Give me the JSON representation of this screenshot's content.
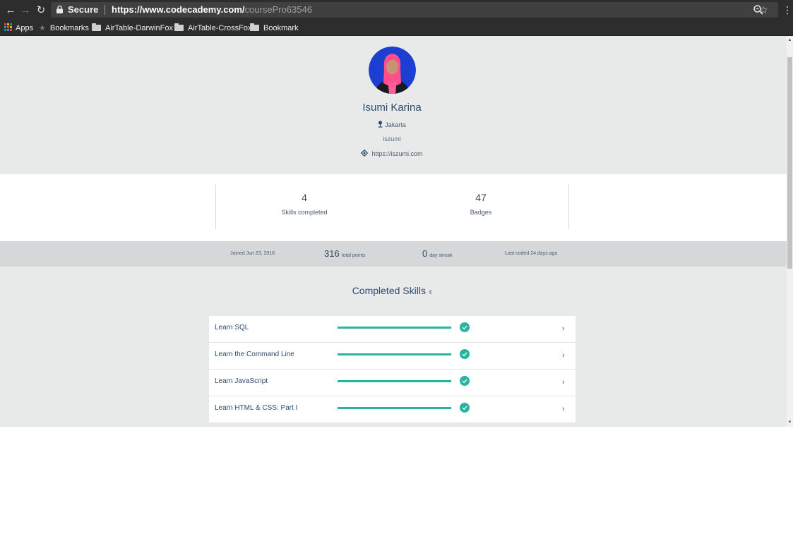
{
  "browser": {
    "back_icon": "arrow-left-icon",
    "forward_icon": "arrow-right-icon",
    "reload_icon": "reload-icon",
    "secure_label": "Secure",
    "url_host": "https://www.codecademy.com/",
    "url_path": "coursePro63546",
    "bookmarks": [
      "Apps",
      "Bookmarks",
      "AirTable-DarwinFox",
      "AirTable-CrossFox",
      "Bookmark"
    ]
  },
  "profile": {
    "name": "Isumi Karina",
    "location": "Jakarta",
    "username": "iszumi",
    "website": "https://iszumi.com"
  },
  "stats": {
    "skills_value": "4",
    "skills_label": "Skills completed",
    "badges_value": "47",
    "badges_label": "Badges"
  },
  "activity": {
    "joined": "Joined Jun 23, 2016",
    "points_value": "316",
    "points_label": "total points",
    "streak_value": "0",
    "streak_label": "day streak",
    "last_coded": "Last coded 24 days ago"
  },
  "completed": {
    "title": "Completed Skills",
    "count": "4",
    "skills": [
      {
        "name": "Learn SQL",
        "progress": 1.0,
        "status_icon": "check-circle-icon"
      },
      {
        "name": "Learn the Command Line",
        "progress": 1.0,
        "status_icon": "check-circle-icon"
      },
      {
        "name": "Learn JavaScript",
        "progress": 1.0,
        "status_icon": "check-circle-icon"
      },
      {
        "name": "Learn HTML & CSS: Part I",
        "progress": 1.0,
        "status_icon": "check-circle-icon"
      }
    ]
  },
  "colors": {
    "accent": "#2bb3a0",
    "text": "#2e4a6b",
    "header_bg": "#e8eaea",
    "chrome_bg": "#2d2d2d"
  }
}
